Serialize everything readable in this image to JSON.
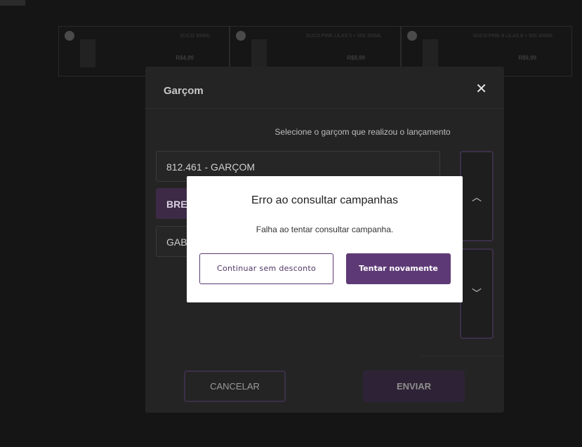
{
  "background_cards": [
    {
      "name": "SUCO 300ML",
      "price": "R$4,99"
    },
    {
      "name": "SUCO PINK LILAS 5 + 500 300ML",
      "price": "R$9,99"
    },
    {
      "name": "SUCO PINK 8 LILAS 8 + 500 300ML",
      "price": "R$9,99"
    }
  ],
  "waiter_modal": {
    "title": "Garçom",
    "close_icon": "close-icon",
    "instruction": "Selecione o garçom que realizou o lançamento",
    "items": [
      {
        "label": "812.461 - GARÇOM"
      },
      {
        "label": "BRE"
      },
      {
        "label": "GAB"
      }
    ],
    "scroll_up_icon": "chevron-up-icon",
    "scroll_down_icon": "chevron-down-icon",
    "cancel_label": "CANCELAR",
    "send_label": "ENVIAR"
  },
  "error_dialog": {
    "title": "Erro ao consultar campanhas",
    "message": "Falha ao tentar consultar campanha.",
    "secondary_label": "Continuar sem desconto",
    "primary_label": "Tentar novamente"
  },
  "colors": {
    "brand": "#5d3a76",
    "overlay": "#151515"
  }
}
